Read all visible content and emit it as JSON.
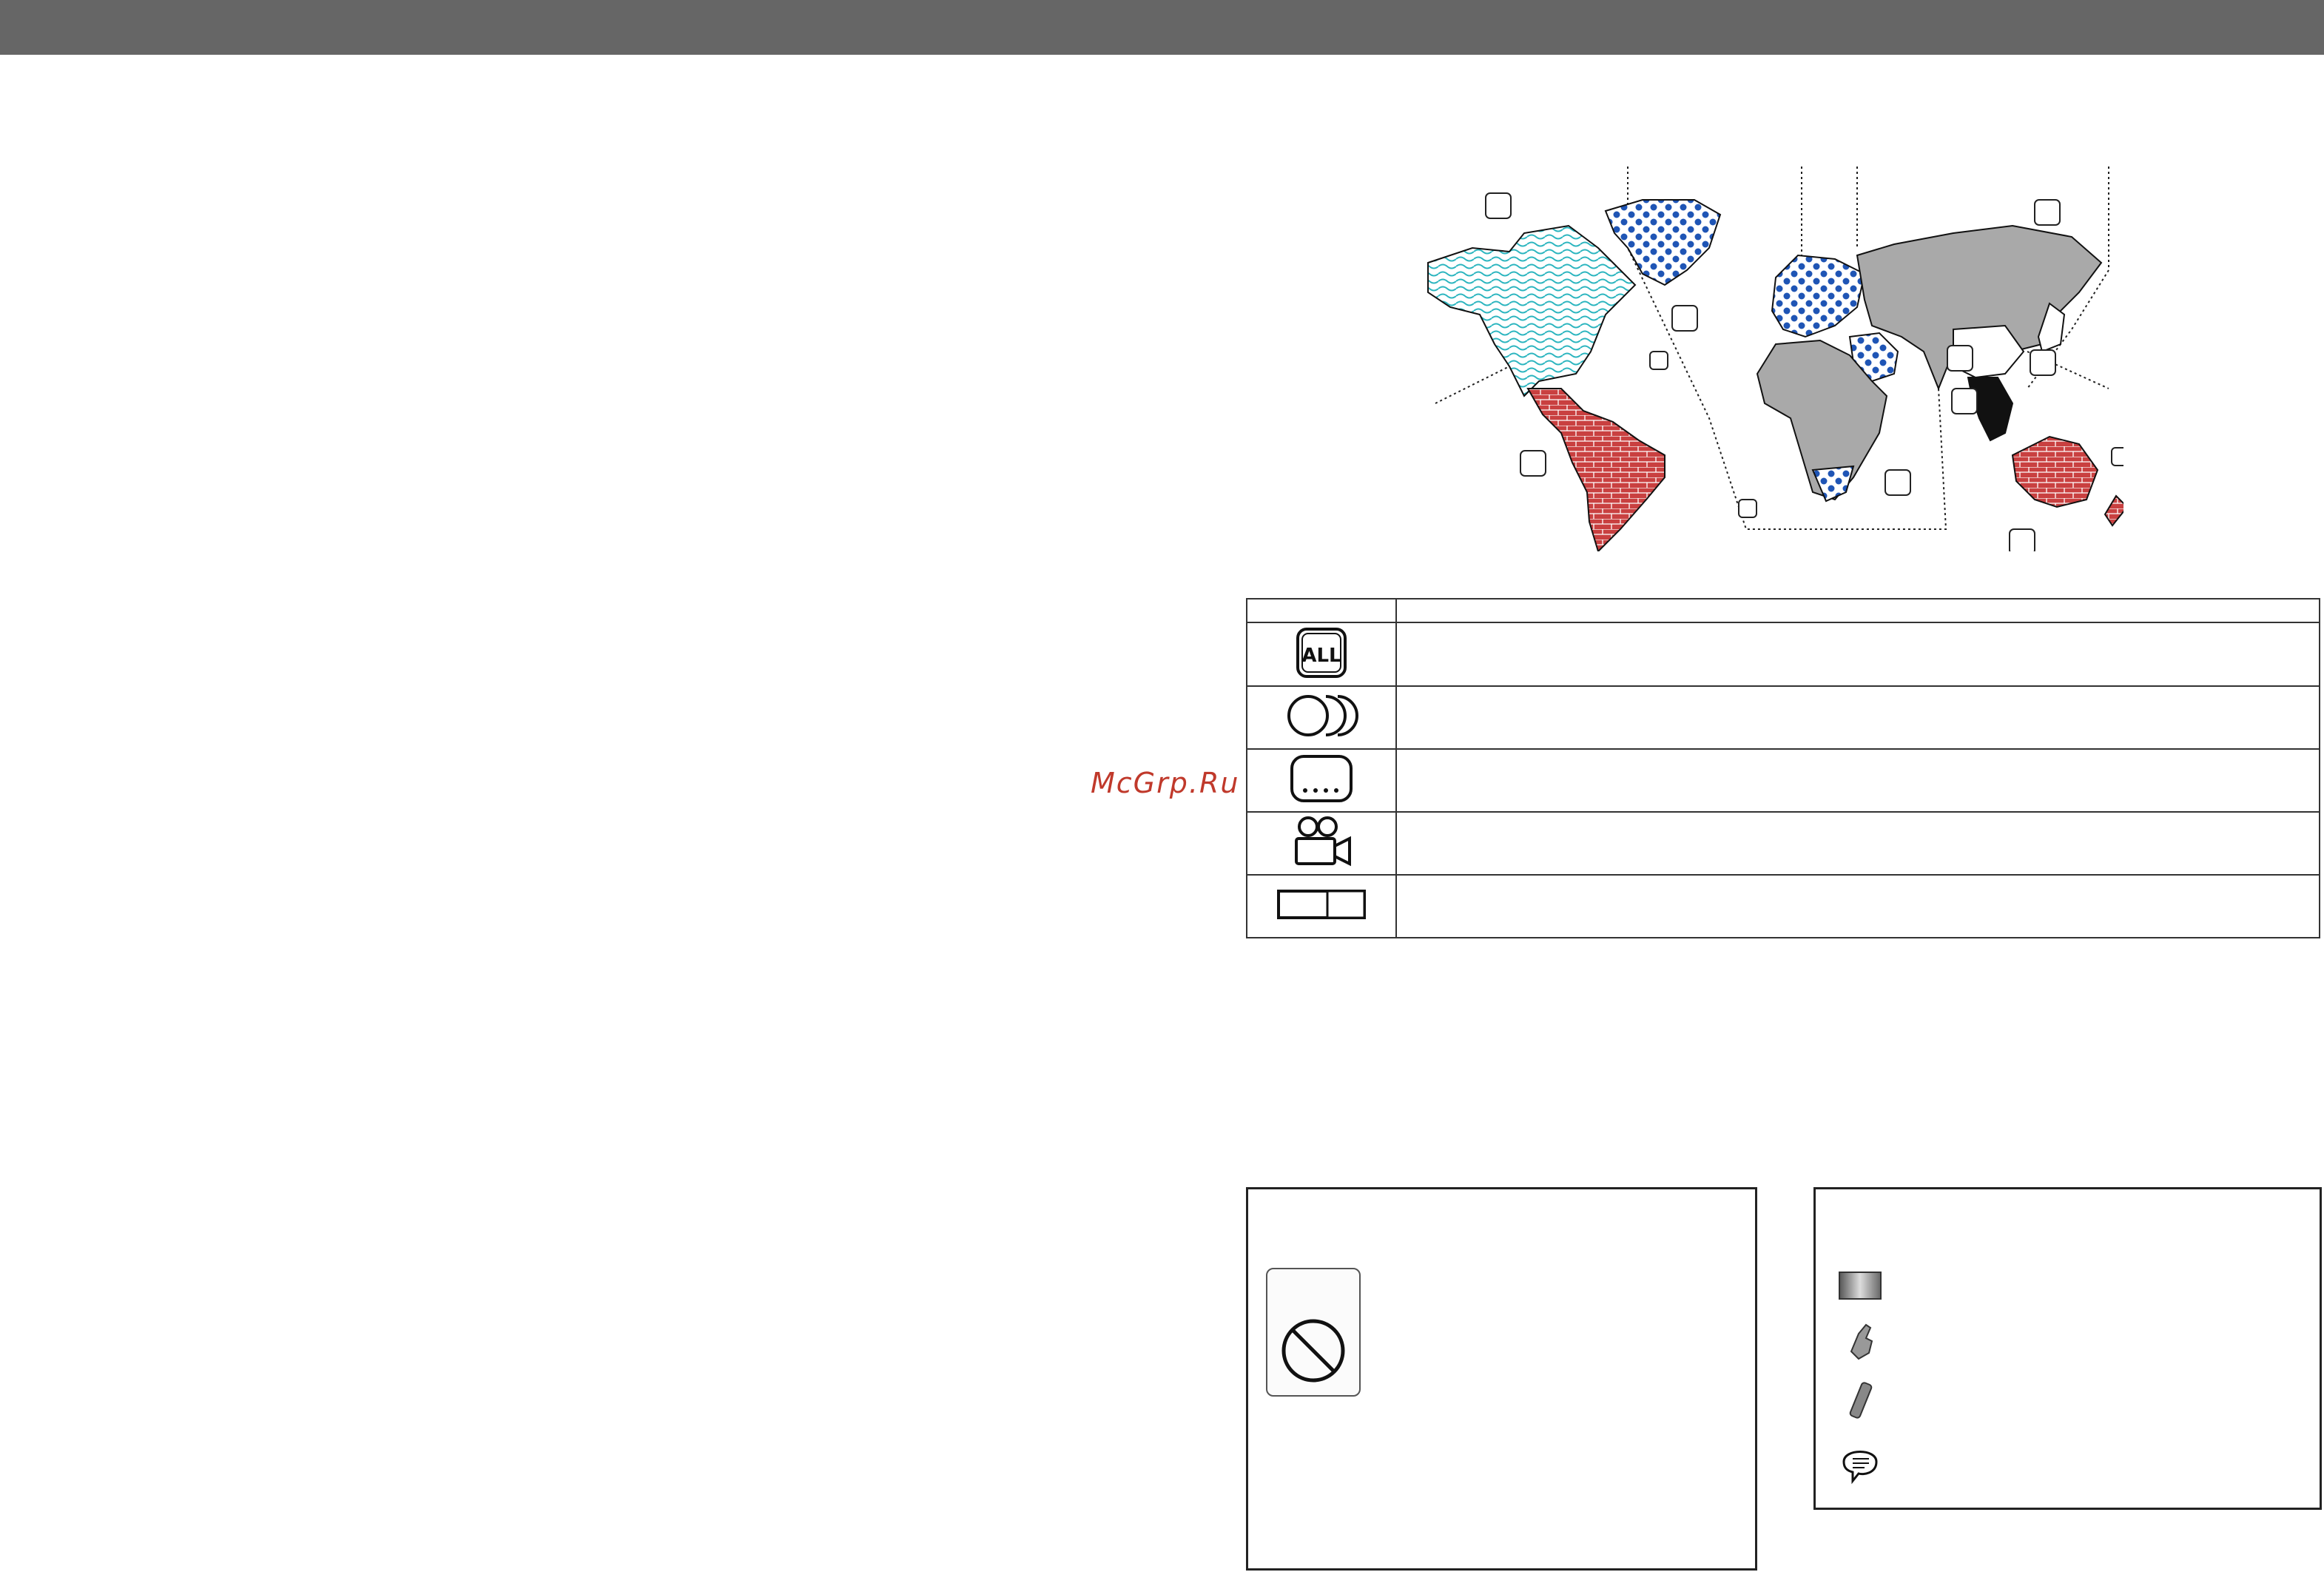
{
  "header": {
    "bar_color": "#666666"
  },
  "watermark": {
    "text": "McGrp.Ru",
    "color": "#c0392b"
  },
  "region_map": {
    "zone_colors": {
      "blue_waves": "#2bb5bf",
      "blue_dots": "#1f55b5",
      "red_brick": "#c94040",
      "gray": "#a9a9a9"
    }
  },
  "icon_table": {
    "header_cells": [
      "",
      ""
    ],
    "rows": [
      {
        "icon": "all-regions-icon",
        "text": ""
      },
      {
        "icon": "multi-audio-icon",
        "text": ""
      },
      {
        "icon": "subtitle-icon",
        "text": ""
      },
      {
        "icon": "multi-angle-icon",
        "text": ""
      },
      {
        "icon": "aspect-ratio-icon",
        "text": ""
      }
    ]
  },
  "box_left": {
    "icon": "prohibited-icon"
  },
  "box_right": {
    "items": [
      {
        "icon": "monitor-icon",
        "text": ""
      },
      {
        "icon": "finger-touch-icon",
        "text": ""
      },
      {
        "icon": "remote-control-icon",
        "text": ""
      },
      {
        "icon": "speech-bubble-icon",
        "text": ""
      }
    ]
  }
}
